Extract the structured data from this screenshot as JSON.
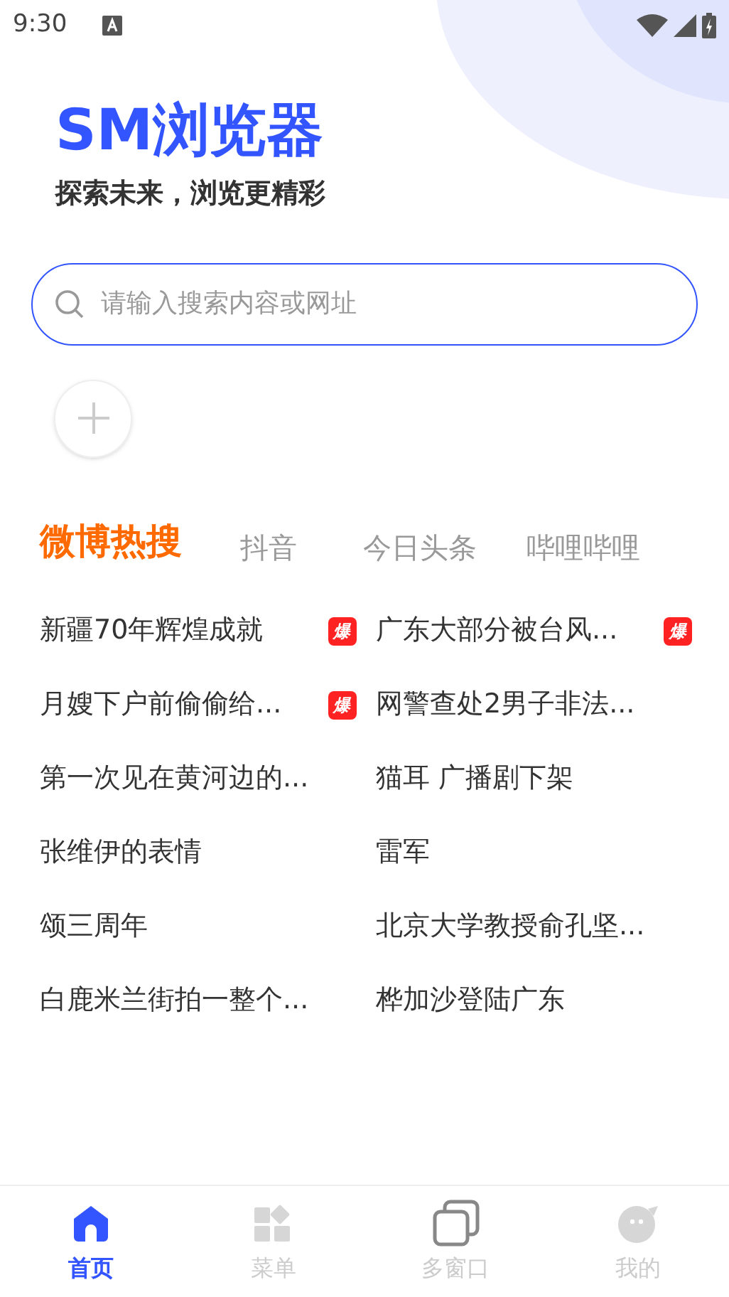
{
  "status_bar": {
    "time": "9:30"
  },
  "brand": {
    "title": "SM浏览器",
    "slogan": "探索未来，浏览更精彩"
  },
  "search": {
    "placeholder": "请输入搜索内容或网址"
  },
  "tabs": [
    {
      "label": "微博热搜",
      "selected": true
    },
    {
      "label": "抖音",
      "selected": false
    },
    {
      "label": "今日头条",
      "selected": false
    },
    {
      "label": "哔哩哔哩",
      "selected": false
    }
  ],
  "hot_items": [
    {
      "title": "新疆70年辉煌成就",
      "badge": "爆"
    },
    {
      "title": "广东大部分被台风...",
      "badge": "爆"
    },
    {
      "title": "月嫂下户前偷偷给...",
      "badge": "爆"
    },
    {
      "title": "网警查处2男子非法..."
    },
    {
      "title": "第一次见在黄河边的..."
    },
    {
      "title": "猫耳 广播剧下架"
    },
    {
      "title": "张维伊的表情"
    },
    {
      "title": "雷军"
    },
    {
      "title": "颂三周年"
    },
    {
      "title": "北京大学教授俞孔坚..."
    },
    {
      "title": "白鹿米兰街拍一整个..."
    },
    {
      "title": "桦加沙登陆广东"
    }
  ],
  "bottom_nav": [
    {
      "kind": "home",
      "label": "首页",
      "selected": true
    },
    {
      "kind": "menu",
      "label": "菜单",
      "selected": false
    },
    {
      "kind": "windows",
      "label": "多窗口",
      "selected": false
    },
    {
      "kind": "profile",
      "label": "我的",
      "selected": false
    }
  ]
}
